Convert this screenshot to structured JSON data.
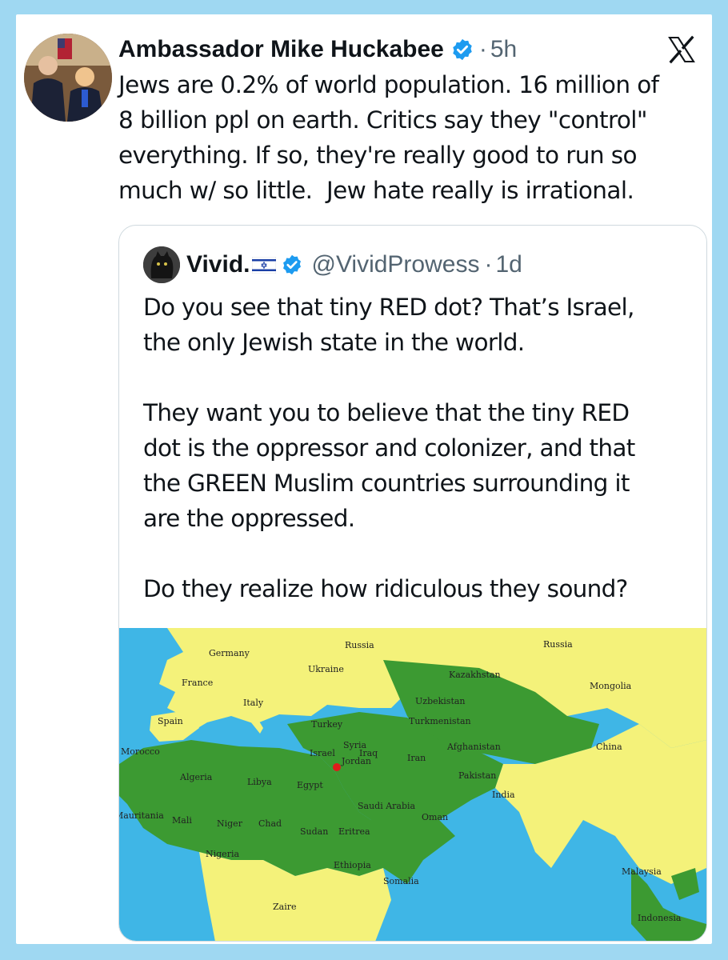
{
  "tweet": {
    "author_name": "Ambassador Mike Huckabee",
    "time_sep": "·",
    "time": "5h",
    "text": "Jews are 0.2% of world population. 16 million of\n8 billion ppl on earth. Critics say they \"control\"\neverything. If so, they're really good to run so\nmuch w/ so little.  Jew hate really is irrational.",
    "avatar_icon": "author-photo",
    "verified_icon": "verified-badge-icon",
    "platform_icon": "x-logo-icon"
  },
  "quote": {
    "author_name": "Vivid.",
    "flag_icon": "israel-flag-emoji",
    "handle": "@VividProwess",
    "time_sep": "·",
    "time": "1d",
    "text": "Do you see that tiny RED dot? That’s Israel,\nthe only Jewish state in the world.\n\nThey want you to believe that the tiny RED\ndot is the oppressor and colonizer, and that\nthe GREEN Muslim countries surrounding it\nare the oppressed.\n\nDo they realize how ridiculous they sound?"
  },
  "map": {
    "labels": {
      "russia_west": "Russia",
      "russia_east": "Russia",
      "germany": "Germany",
      "ukraine": "Ukraine",
      "kazakhstan": "Kazakhstan",
      "mongolia": "Mongolia",
      "france": "France",
      "uzbekistan": "Uzbekistan",
      "spain": "Spain",
      "turkey": "Turkey",
      "turkmenistan": "Turkmenistan",
      "italy": "Italy",
      "syria": "Syria",
      "israel": "Israel",
      "iraq": "Iraq",
      "jordan": "Jordan",
      "iran": "Iran",
      "afghanistan": "Afghanistan",
      "china": "China",
      "morocco": "Morocco",
      "pakistan": "Pakistan",
      "algeria": "Algeria",
      "libya": "Libya",
      "egypt": "Egypt",
      "india": "India",
      "saudi_arabia": "Saudi Arabia",
      "mauritania": "Mauritania",
      "mali": "Mali",
      "niger": "Niger",
      "chad": "Chad",
      "oman": "Oman",
      "sudan": "Sudan",
      "eritrea": "Eritrea",
      "nigeria": "Nigeria",
      "ethiopia": "Ethiopia",
      "somalia": "Somalia",
      "malaysia": "Malaysia",
      "zaire": "Zaire",
      "indonesia": "Indonesia"
    },
    "colors": {
      "ocean": "#3fb6e6",
      "muslim": "#3c9a32",
      "other": "#f4f27a",
      "israel": "#e01b1b"
    }
  },
  "colors": {
    "page_bg": "#9fd8f2",
    "text": "#0f1419",
    "muted": "#536471",
    "verified": "#1d9bf0"
  }
}
